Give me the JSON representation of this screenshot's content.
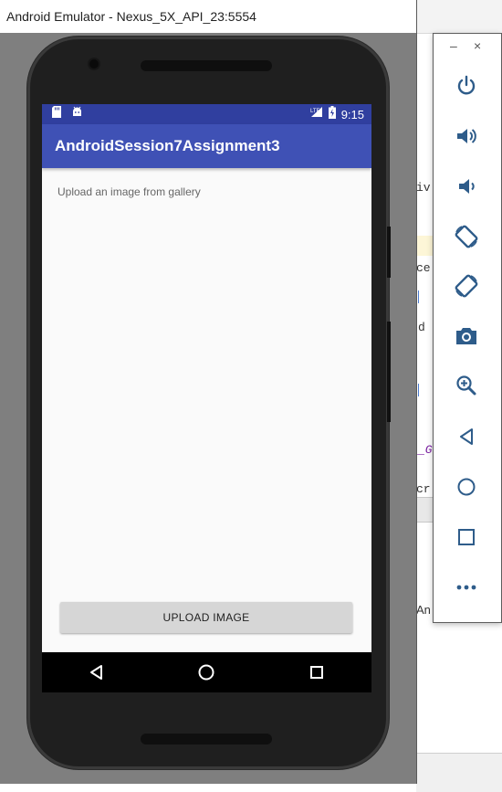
{
  "window": {
    "title": "Android Emulator - Nexus_5X_API_23:5554"
  },
  "ide_background": {
    "fragments": [
      "iv",
      "ce",
      "d",
      "_GI",
      "cr",
      "An"
    ]
  },
  "status_bar": {
    "time": "9:15",
    "left_icons": [
      "sd-card-icon",
      "android-debug-icon"
    ],
    "right_icons": [
      "signal-icon",
      "battery-charging-icon"
    ]
  },
  "app": {
    "title": "AndroidSession7Assignment3",
    "instruction": "Upload an image from gallery",
    "upload_button_label": "UPLOAD IMAGE"
  },
  "nav_bar": {
    "buttons": [
      "back-icon",
      "home-icon",
      "recents-icon"
    ]
  },
  "toolbar": {
    "minimize_label": "–",
    "close_label": "×",
    "buttons": [
      "power",
      "volume-up",
      "volume-down",
      "rotate-left",
      "rotate-right",
      "screenshot",
      "zoom",
      "back",
      "home",
      "overview",
      "more"
    ]
  },
  "colors": {
    "status_bar": "#303f9f",
    "app_bar": "#3f51b5",
    "toolbar_icons": "#2e5c8a",
    "screen_bg": "#fafafa",
    "button_bg": "#d6d6d6"
  }
}
